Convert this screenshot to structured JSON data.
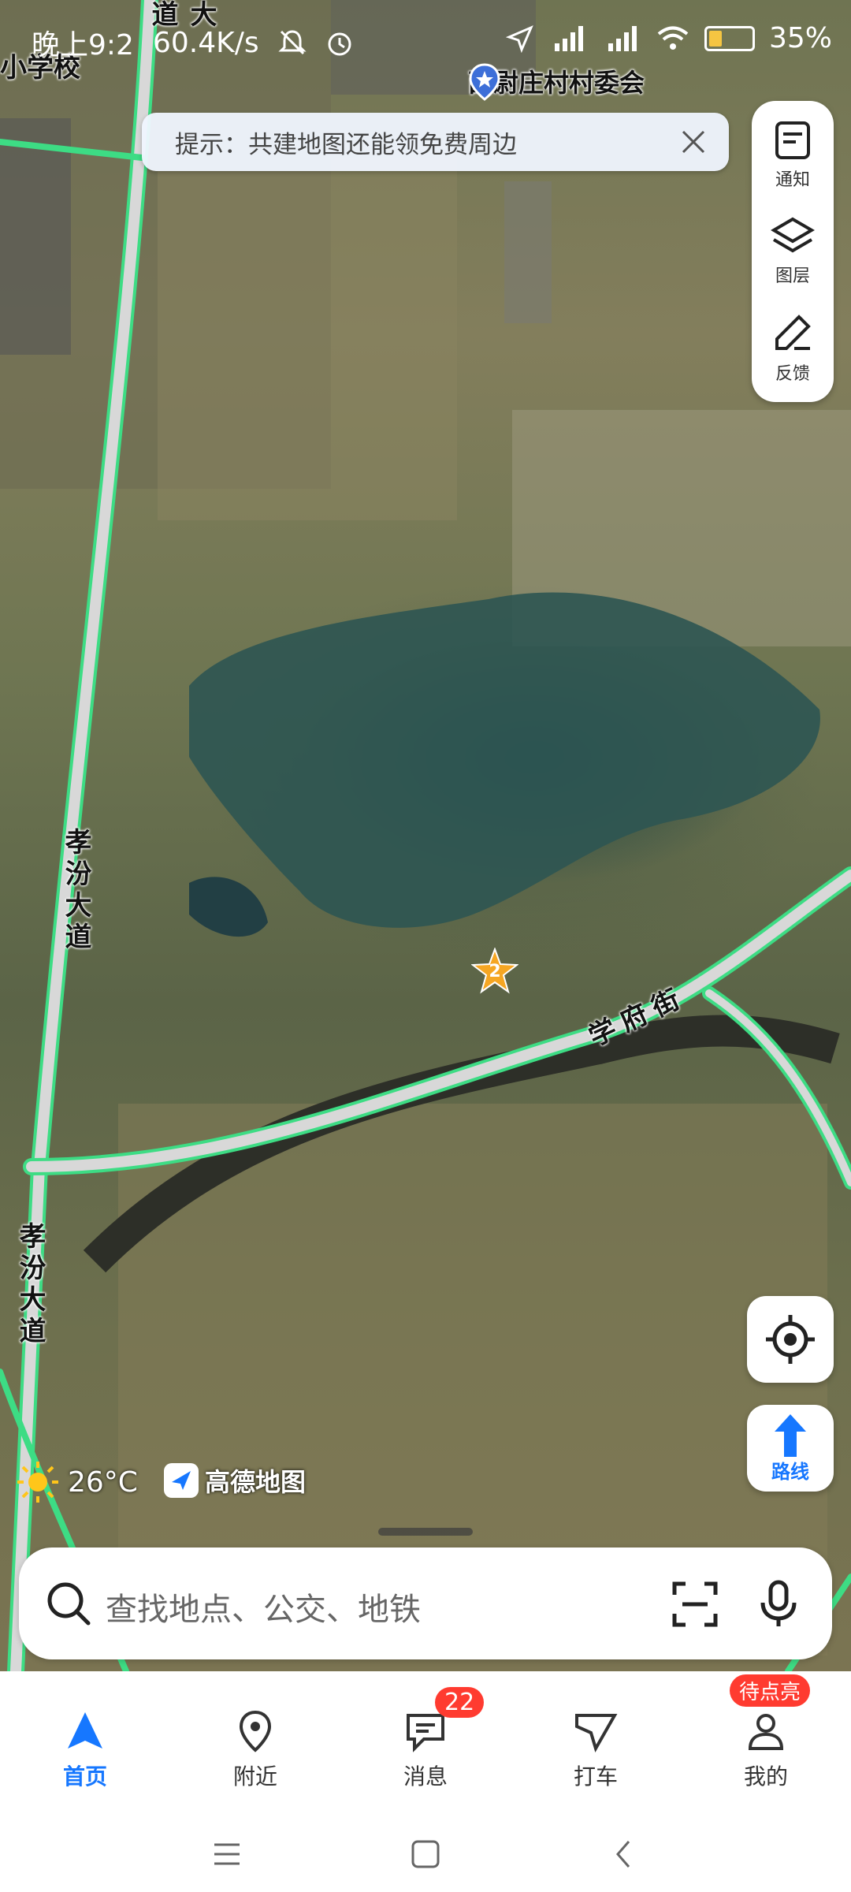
{
  "status_bar": {
    "time": "晚上9:2",
    "network_speed": "60.4K/s",
    "battery_percent": "35%",
    "battery_level": 0.35
  },
  "map": {
    "poi_top_left": "小学校",
    "poi_village_committee": "西尉庄村村委会",
    "road_vertical_top": "孝汾大道",
    "road_vertical_bottom": "孝汾大道",
    "road_xuefu": "学府街",
    "partial_road_top": "大道",
    "marker_number": "2"
  },
  "banner": {
    "text": "提示：共建地图还能领免费周边",
    "close_icon": "close-icon"
  },
  "toolbar": {
    "items": [
      {
        "label": "通知",
        "icon": "notice-icon"
      },
      {
        "label": "图层",
        "icon": "layers-icon"
      },
      {
        "label": "反馈",
        "icon": "feedback-icon"
      }
    ]
  },
  "controls": {
    "route_label": "路线"
  },
  "weather": {
    "temperature": "26°C",
    "icon": "sun-icon"
  },
  "brand": {
    "logo_text": "高德地图"
  },
  "search": {
    "placeholder": "查找地点、公交、地铁"
  },
  "nav": {
    "items": [
      {
        "label": "首页",
        "icon": "home-arrow-icon",
        "active": true
      },
      {
        "label": "附近",
        "icon": "location-pin-icon"
      },
      {
        "label": "消息",
        "icon": "message-icon",
        "badge": "22"
      },
      {
        "label": "打车",
        "icon": "taxi-icon"
      },
      {
        "label": "我的",
        "icon": "profile-icon",
        "badge": "待点亮"
      }
    ]
  },
  "colors": {
    "accent": "#1677ff",
    "badge": "#ff3b30",
    "road_edge": "#3ddc84",
    "marker": "#f5a623"
  }
}
